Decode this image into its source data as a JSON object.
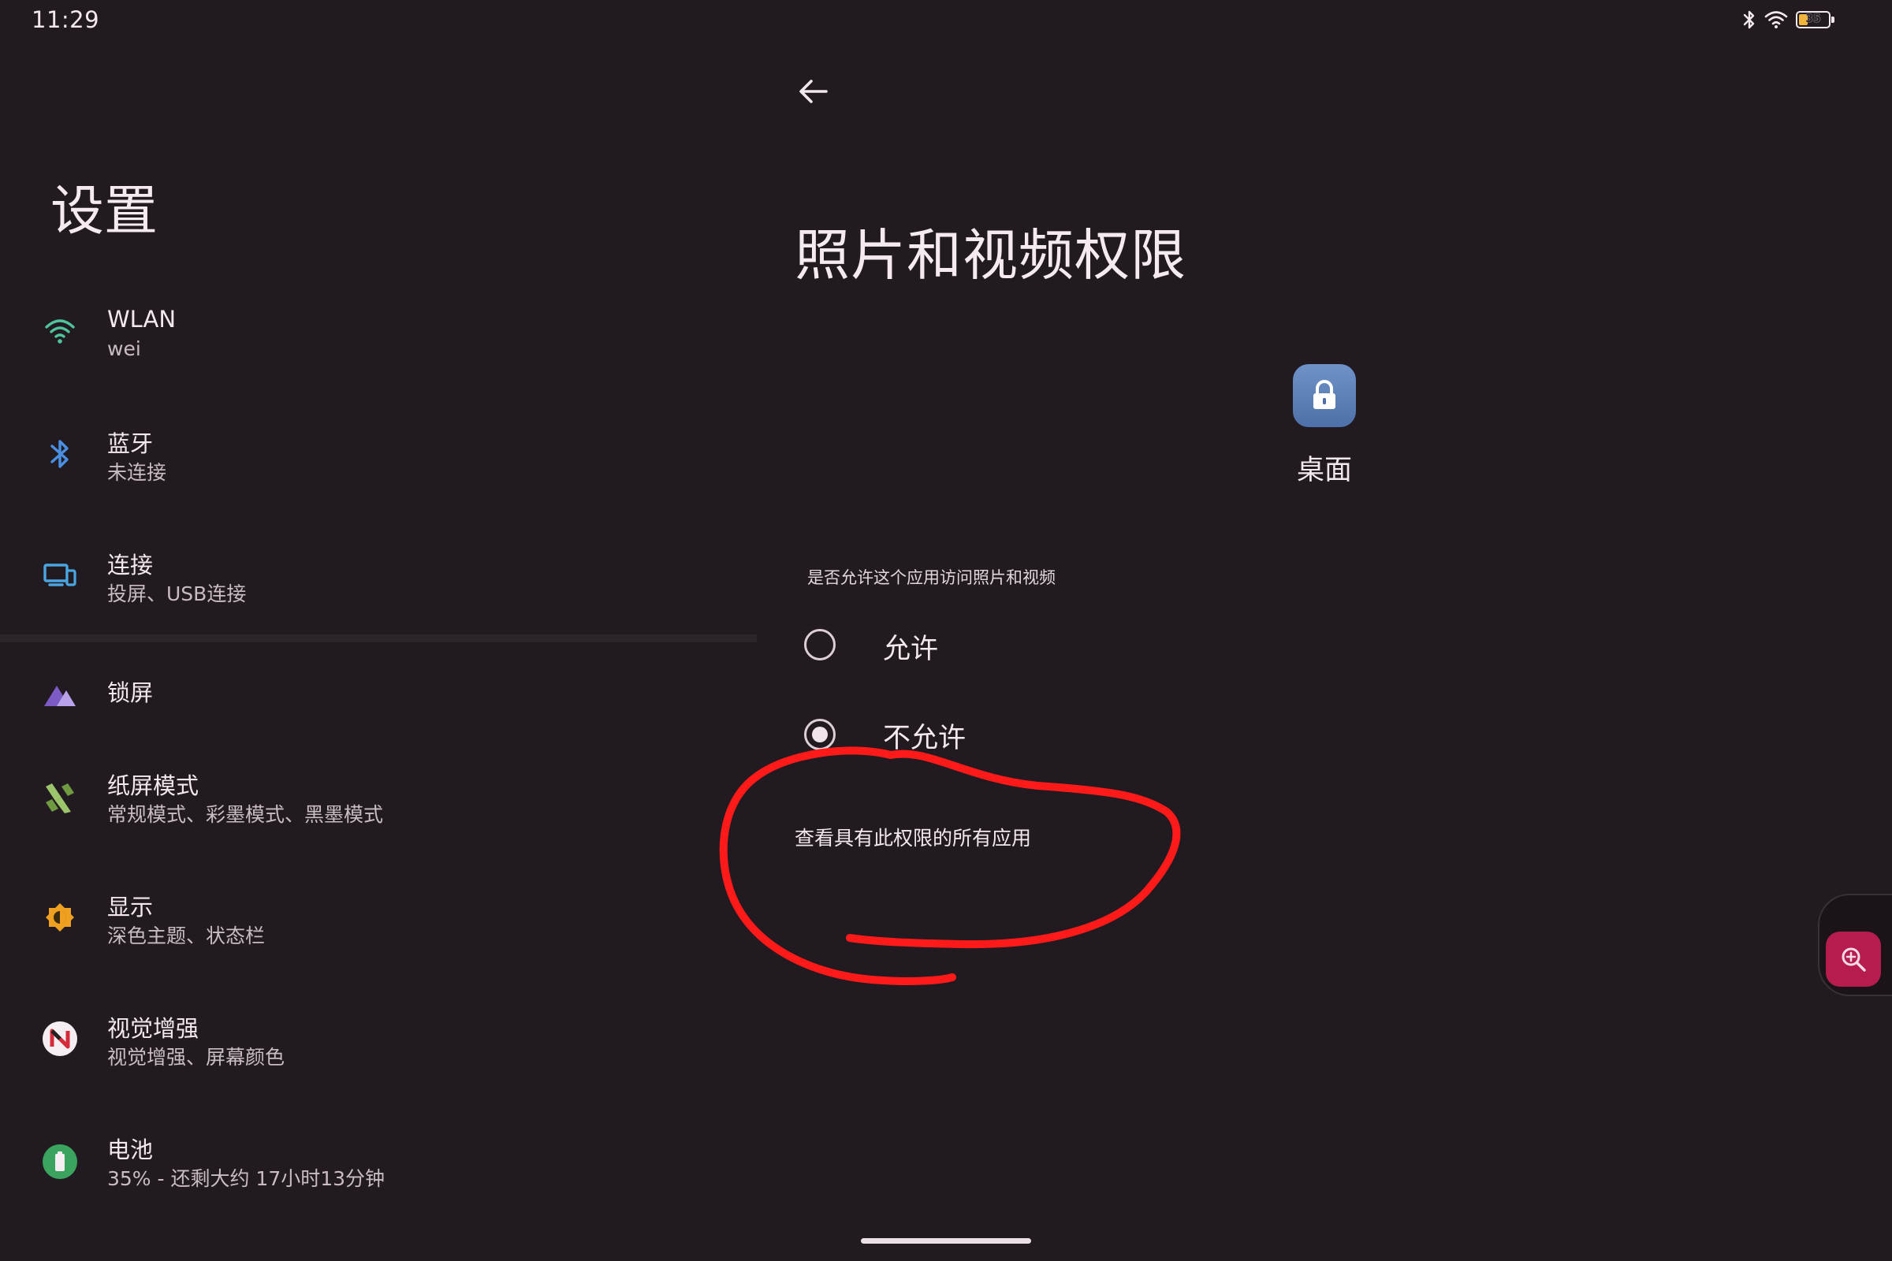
{
  "status_bar": {
    "time": "11:29",
    "battery_level": "35",
    "icons": [
      "bluetooth-icon",
      "wifi-icon",
      "battery-icon"
    ]
  },
  "sidebar": {
    "title": "设置",
    "items": [
      {
        "icon": "wifi-icon",
        "title": "WLAN",
        "subtitle": "wei"
      },
      {
        "icon": "bluetooth-icon",
        "title": "蓝牙",
        "subtitle": "未连接"
      },
      {
        "icon": "devices-icon",
        "title": "连接",
        "subtitle": "投屏、USB连接"
      },
      {
        "icon": "lockscreen-icon",
        "title": "锁屏",
        "subtitle": ""
      },
      {
        "icon": "paper-mode-icon",
        "title": "纸屏模式",
        "subtitle": "常规模式、彩墨模式、黑墨模式"
      },
      {
        "icon": "brightness-icon",
        "title": "显示",
        "subtitle": "深色主题、状态栏"
      },
      {
        "icon": "vision-enhance-icon",
        "title": "视觉增强",
        "subtitle": "视觉增强、屏幕颜色"
      },
      {
        "icon": "battery-icon",
        "title": "电池",
        "subtitle": "35% - 还剩大约 17小时13分钟"
      }
    ]
  },
  "detail": {
    "back_icon": "arrow-back-icon",
    "title": "照片和视频权限",
    "app": {
      "icon": "lock-icon",
      "name": "桌面"
    },
    "question": "是否允许这个应用访问照片和视频",
    "options": [
      {
        "label": "允许",
        "selected": false
      },
      {
        "label": "不允许",
        "selected": true
      }
    ],
    "see_all_link": "查看具有此权限的所有应用"
  },
  "floating": {
    "icon": "zoom-in-icon"
  },
  "colors": {
    "background": "#211a20",
    "text": "#f2e8ee",
    "annotation": "#ff1a1a",
    "zoom_button": "#b61d4e",
    "app_icon": "#5b7fb8"
  }
}
